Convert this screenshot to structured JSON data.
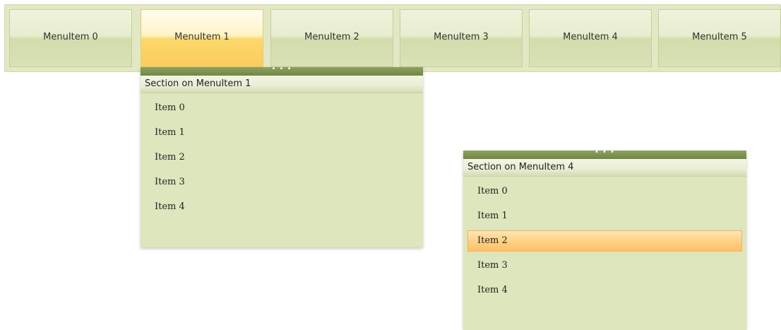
{
  "menubar": {
    "items": [
      {
        "label": "MenuItem 0"
      },
      {
        "label": "MenuItem 1"
      },
      {
        "label": "MenuItem 2"
      },
      {
        "label": "MenuItem 3"
      },
      {
        "label": "MenuItem 4"
      },
      {
        "label": "MenuItem 5"
      }
    ],
    "active_index": 1
  },
  "panels": [
    {
      "grip": "• • •",
      "header": "Section on MenuItem 1",
      "items": [
        "Item 0",
        "Item 1",
        "Item 2",
        "Item 3",
        "Item 4"
      ]
    },
    {
      "grip": "• • •",
      "header": "Section on MenuItem 4",
      "items": [
        "Item 0",
        "Item 1",
        "Item 2",
        "Item 3",
        "Item 4"
      ],
      "highlighted_index": 2
    }
  ],
  "colors": {
    "menubar_bg": "#e2e8c4",
    "active_item": "#f9cd5e",
    "panel_bg": "#dde6bc",
    "grip": "#7a9150",
    "hover_item": "#ffc06a"
  }
}
